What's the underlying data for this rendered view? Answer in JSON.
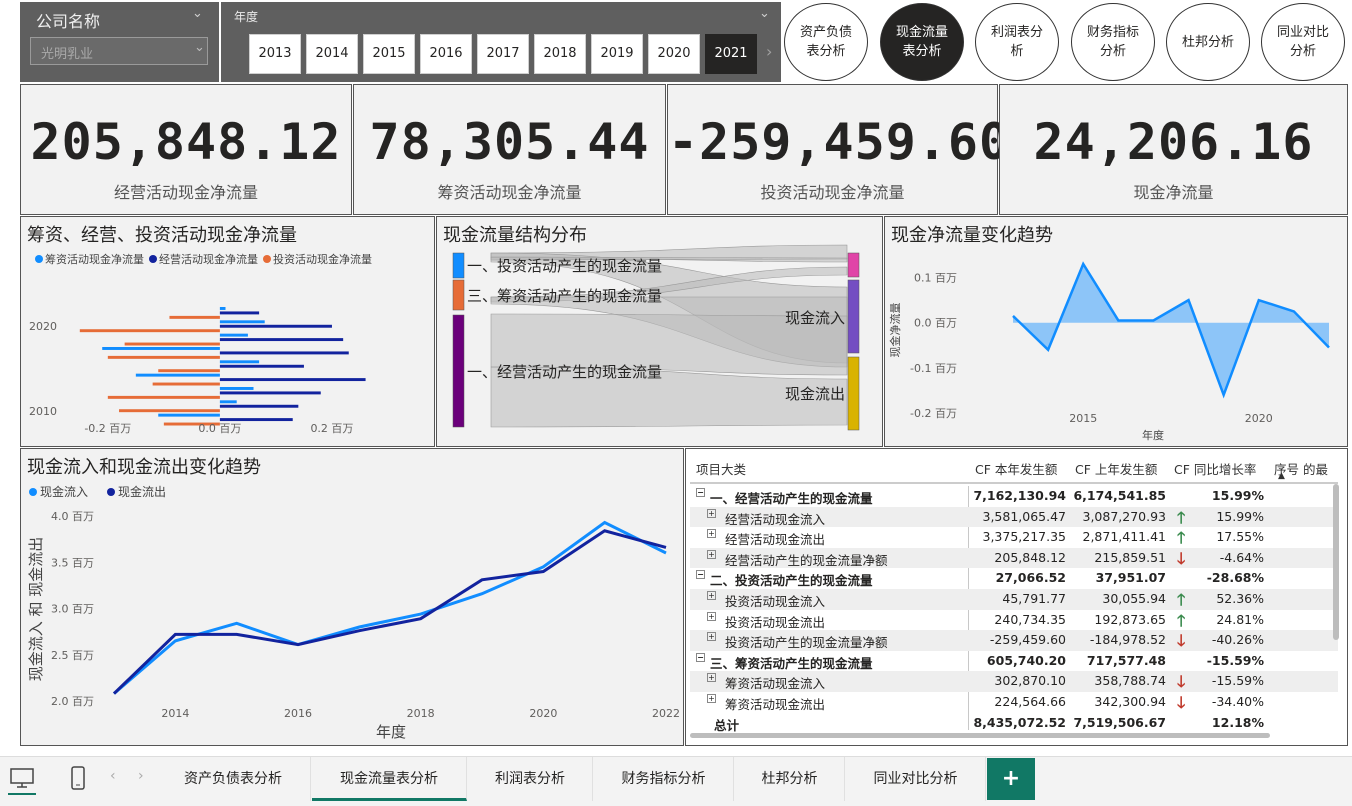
{
  "slicers": {
    "company_label": "公司名称",
    "company_value": "光明乳业",
    "year_label": "年度",
    "years": [
      "2013",
      "2014",
      "2015",
      "2016",
      "2017",
      "2018",
      "2019",
      "2020",
      "2021"
    ],
    "selected_year": "2021"
  },
  "nav_buttons": [
    {
      "line1": "资产负债",
      "line2": "表分析",
      "active": false
    },
    {
      "line1": "现金流量",
      "line2": "表分析",
      "active": true
    },
    {
      "line1": "利润表分",
      "line2": "析",
      "active": false
    },
    {
      "line1": "财务指标",
      "line2": "分析",
      "active": false
    },
    {
      "line1": "杜邦分析",
      "line2": "",
      "active": false
    },
    {
      "line1": "同业对比",
      "line2": "分析",
      "active": false
    }
  ],
  "kpis": [
    {
      "value": "205,848.12",
      "label": "经营活动现金净流量"
    },
    {
      "value": "78,305.44",
      "label": "筹资活动现金净流量"
    },
    {
      "value": "-259,459.60",
      "label": "投资活动现金净流量"
    },
    {
      "value": "24,206.16",
      "label": "现金净流量"
    }
  ],
  "panels": {
    "bar_title": "筹资、经营、投资活动现金净流量",
    "sankey_title": "现金流量结构分布",
    "trend_title": "现金净流量变化趋势",
    "inout_title": "现金流入和现金流出变化趋势"
  },
  "colors": {
    "financing": "#118DFF",
    "operating": "#12239E",
    "investing": "#E66C37",
    "line_in": "#118DFF",
    "line_out": "#12239E",
    "dark": "#252423",
    "accent_green": "#117865",
    "up_arrow": "#3b8b4e",
    "down_arrow": "#c0392b",
    "sankey_invest": "#118DFF",
    "sankey_finance": "#E66C37",
    "sankey_oper": "#6B007B",
    "sankey_in": "#744EC2",
    "sankey_out": "#D9B300",
    "sankey_top": "#E044A7"
  },
  "chart_data": [
    {
      "type": "bar",
      "orientation": "horizontal",
      "title": "筹资、经营、投资活动现金净流量",
      "legend": [
        "筹资活动现金净流量",
        "经营活动现金净流量",
        "投资活动现金净流量"
      ],
      "legend_position": "top-left",
      "y_ticks": [
        "2020",
        "2010"
      ],
      "x_ticks": [
        "-0.2 百万",
        "0.0 百万",
        "0.2 百万"
      ],
      "xlim": [
        -0.28,
        0.35
      ],
      "rows": [
        {
          "series": 0,
          "value": 0.01
        },
        {
          "series": 1,
          "value": 0.07
        },
        {
          "series": 2,
          "value": -0.09
        },
        {
          "series": 0,
          "value": 0.08
        },
        {
          "series": 1,
          "value": 0.2
        },
        {
          "series": 2,
          "value": -0.25
        },
        {
          "series": 0,
          "value": 0.05
        },
        {
          "series": 1,
          "value": 0.22
        },
        {
          "series": 2,
          "value": -0.17
        },
        {
          "series": 0,
          "value": -0.21
        },
        {
          "series": 1,
          "value": 0.23
        },
        {
          "series": 2,
          "value": -0.2
        },
        {
          "series": 0,
          "value": 0.07
        },
        {
          "series": 1,
          "value": 0.15
        },
        {
          "series": 2,
          "value": -0.11
        },
        {
          "series": 0,
          "value": -0.15
        },
        {
          "series": 1,
          "value": 0.26
        },
        {
          "series": 2,
          "value": -0.12
        },
        {
          "series": 0,
          "value": 0.06
        },
        {
          "series": 1,
          "value": 0.18
        },
        {
          "series": 2,
          "value": -0.2
        },
        {
          "series": 0,
          "value": 0.03
        },
        {
          "series": 1,
          "value": 0.14
        },
        {
          "series": 2,
          "value": -0.18
        },
        {
          "series": 0,
          "value": -0.11
        },
        {
          "series": 1,
          "value": 0.13
        },
        {
          "series": 2,
          "value": -0.1
        }
      ]
    },
    {
      "type": "sankey",
      "title": "现金流量结构分布",
      "sources": [
        "一、投资活动产生的现金流量",
        "三、筹资活动产生的现金流量",
        "一、经营活动产生的现金流量"
      ],
      "targets": [
        "现金流入",
        "现金流出"
      ]
    },
    {
      "type": "area",
      "title": "现金净流量变化趋势",
      "xlabel": "年度",
      "ylabel": "现金净流量",
      "x": [
        2013,
        2014,
        2015,
        2016,
        2017,
        2018,
        2019,
        2020,
        2021,
        2022
      ],
      "values": [
        0.015,
        -0.06,
        0.13,
        0.005,
        0.005,
        0.05,
        -0.16,
        0.05,
        0.025,
        -0.055
      ],
      "y_ticks": [
        "0.1 百万",
        "0.0 百万",
        "-0.1 百万",
        "-0.2 百万"
      ],
      "x_ticks": [
        "2015",
        "2020"
      ],
      "ylim": [
        -0.22,
        0.15
      ]
    },
    {
      "type": "line",
      "title": "现金流入和现金流出变化趋势",
      "xlabel": "年度",
      "ylabel": "现金流入 和 现金流出",
      "legend_position": "top-left",
      "x": [
        2013,
        2014,
        2015,
        2016,
        2017,
        2018,
        2019,
        2020,
        2021,
        2022
      ],
      "series": [
        {
          "name": "现金流入",
          "values": [
            2.08,
            2.65,
            2.84,
            2.61,
            2.8,
            2.94,
            3.16,
            3.45,
            3.93,
            3.6
          ]
        },
        {
          "name": "现金流出",
          "values": [
            2.08,
            2.72,
            2.72,
            2.61,
            2.76,
            2.89,
            3.31,
            3.4,
            3.84,
            3.66
          ]
        }
      ],
      "y_ticks": [
        "4.0 百万",
        "3.5 百万",
        "3.0 百万",
        "2.5 百万",
        "2.0 百万"
      ],
      "x_ticks": [
        "2014",
        "2016",
        "2018",
        "2020",
        "2022"
      ],
      "ylim": [
        2.0,
        4.0
      ]
    }
  ],
  "table": {
    "headers": [
      "项目大类",
      "CF 本年发生额",
      "CF 上年发生额",
      "CF 同比增长率",
      "序号 的最"
    ],
    "rows": [
      {
        "label": "一、经营活动产生的现金流量",
        "cur": "7,162,130.94",
        "prev": "6,174,541.85",
        "arrow": "",
        "rate": "15.99%",
        "bold": true,
        "level": 0
      },
      {
        "label": "经营活动现金流入",
        "cur": "3,581,065.47",
        "prev": "3,087,270.93",
        "arrow": "up",
        "rate": "15.99%",
        "bold": false,
        "level": 1
      },
      {
        "label": "经营活动现金流出",
        "cur": "3,375,217.35",
        "prev": "2,871,411.41",
        "arrow": "up",
        "rate": "17.55%",
        "bold": false,
        "level": 1
      },
      {
        "label": "经营活动产生的现金流量净额",
        "cur": "205,848.12",
        "prev": "215,859.51",
        "arrow": "down",
        "rate": "-4.64%",
        "bold": false,
        "level": 1
      },
      {
        "label": "二、投资活动产生的现金流量",
        "cur": "27,066.52",
        "prev": "37,951.07",
        "arrow": "",
        "rate": "-28.68%",
        "bold": true,
        "level": 0
      },
      {
        "label": "投资活动现金流入",
        "cur": "45,791.77",
        "prev": "30,055.94",
        "arrow": "up",
        "rate": "52.36%",
        "bold": false,
        "level": 1
      },
      {
        "label": "投资活动现金流出",
        "cur": "240,734.35",
        "prev": "192,873.65",
        "arrow": "up",
        "rate": "24.81%",
        "bold": false,
        "level": 1
      },
      {
        "label": "投资活动产生的现金流量净额",
        "cur": "-259,459.60",
        "prev": "-184,978.52",
        "arrow": "down",
        "rate": "-40.26%",
        "bold": false,
        "level": 1
      },
      {
        "label": "三、筹资活动产生的现金流量",
        "cur": "605,740.20",
        "prev": "717,577.48",
        "arrow": "",
        "rate": "-15.59%",
        "bold": true,
        "level": 0
      },
      {
        "label": "筹资活动现金流入",
        "cur": "302,870.10",
        "prev": "358,788.74",
        "arrow": "down",
        "rate": "-15.59%",
        "bold": false,
        "level": 1
      },
      {
        "label": "筹资活动现金流出",
        "cur": "224,564.66",
        "prev": "342,300.94",
        "arrow": "down",
        "rate": "-34.40%",
        "bold": false,
        "level": 1
      }
    ],
    "total": {
      "label": "总计",
      "cur": "8,435,072.52",
      "prev": "7,519,506.67",
      "rate": "12.18%"
    }
  },
  "tabs": [
    "资产负债表分析",
    "现金流量表分析",
    "利润表分析",
    "财务指标分析",
    "杜邦分析",
    "同业对比分析"
  ],
  "active_tab": "现金流量表分析",
  "add_tab_label": "+"
}
